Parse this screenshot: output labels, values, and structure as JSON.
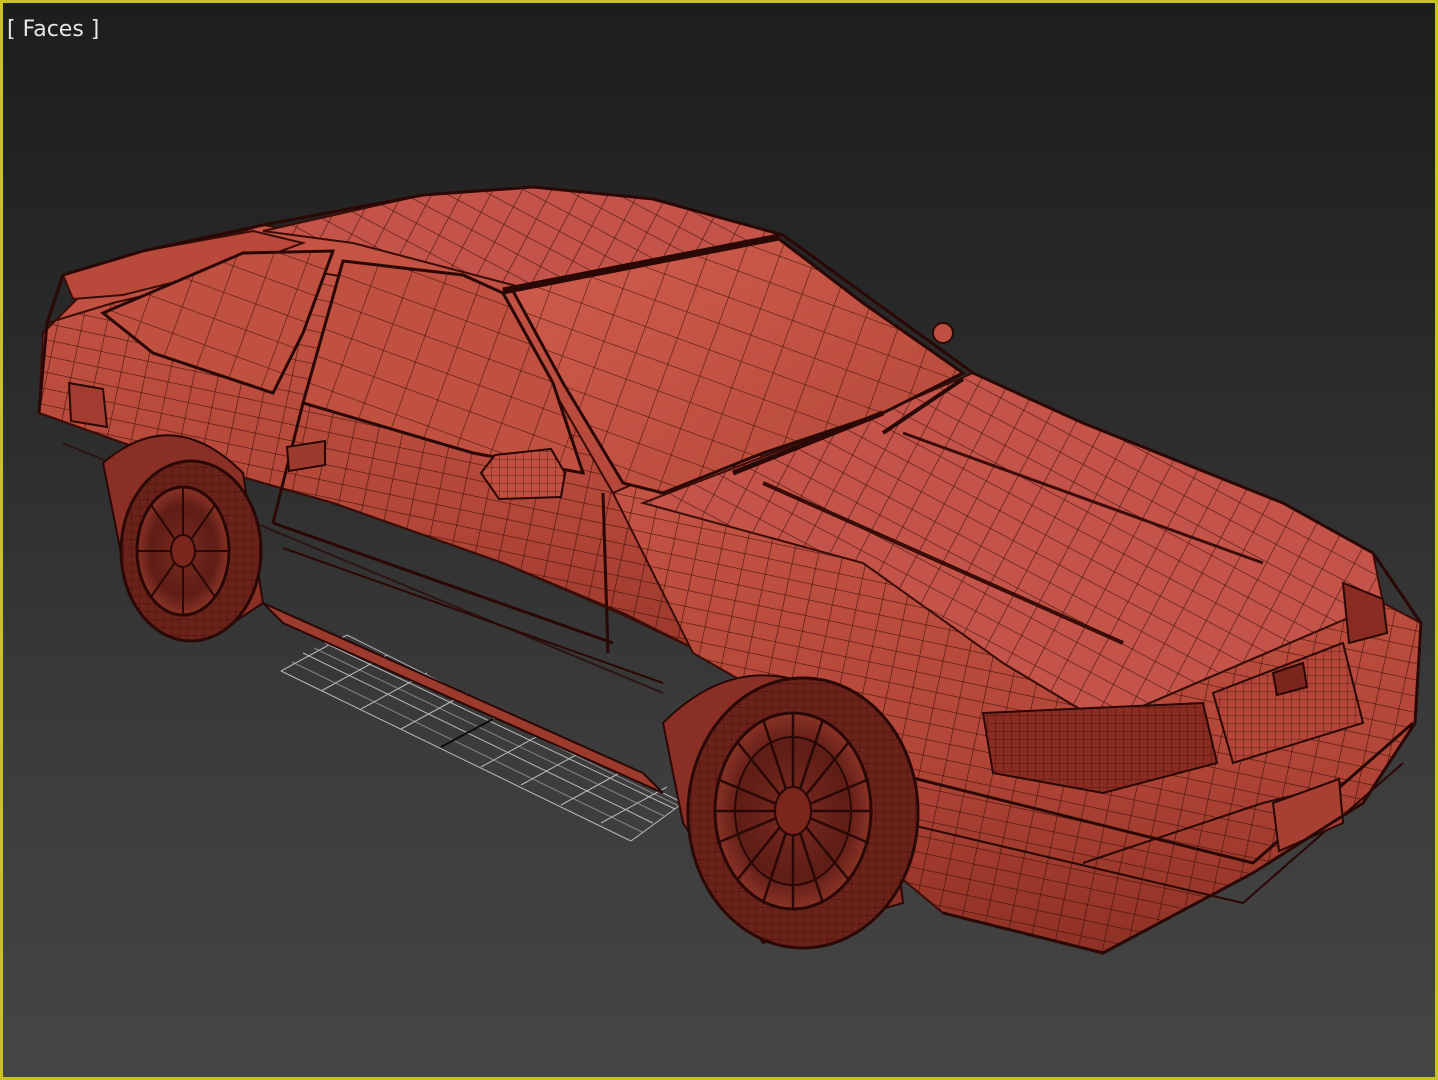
{
  "viewport": {
    "label": "[ Faces ]",
    "border_color": "#c8c31e",
    "shading_mode": "Faces",
    "background_top": "#1d1d1d",
    "background_bottom": "#454545"
  },
  "scene": {
    "object": "car-model",
    "object_color": "#b84a3c",
    "wire_color": "#3a0d08",
    "grid_color": "#d8d8d8"
  }
}
